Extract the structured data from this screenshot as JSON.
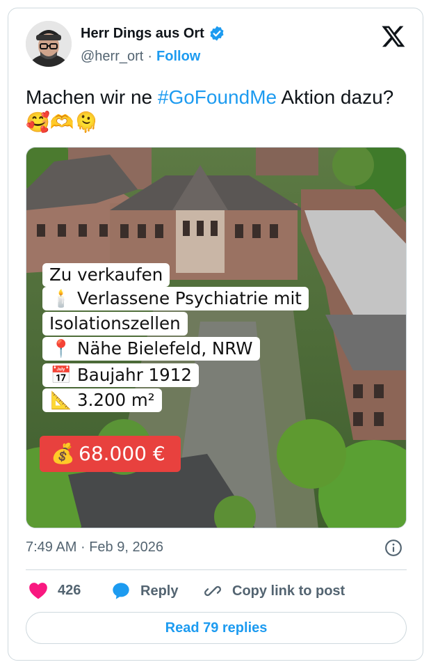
{
  "author": {
    "name": "Herr Dings aus Ort",
    "handle": "@herr_ort",
    "separator": "·",
    "follow_label": "Follow"
  },
  "tweet": {
    "text_before": "Machen wir ne ",
    "hashtag": "#GoFoundMe",
    "text_after": " Aktion dazu? 🥰🫶🫠"
  },
  "media": {
    "lines": [
      {
        "emoji": "",
        "text": "Zu verkaufen"
      },
      {
        "emoji": "🕯️",
        "text": "Verlassene Psychiatrie mit"
      },
      {
        "emoji": "",
        "text": "Isolationszellen"
      },
      {
        "emoji": "📍",
        "text": "Nähe Bielefeld, NRW"
      },
      {
        "emoji": "📅",
        "text": "Baujahr 1912"
      },
      {
        "emoji": "📐",
        "text": "3.200 m²"
      }
    ],
    "price_emoji": "💰",
    "price": "68.000 €"
  },
  "meta": {
    "time": "7:49 AM",
    "separator": "·",
    "date": "Feb 9, 2026"
  },
  "actions": {
    "likes": "426",
    "reply_label": "Reply",
    "copy_label": "Copy link to post"
  },
  "read_replies_label": "Read 79 replies",
  "colors": {
    "link_blue": "#1d9bf0",
    "like_pink": "#f91880",
    "price_red": "#e8413e",
    "muted": "#536471",
    "border": "#cfd9de"
  },
  "icons": [
    "verified-badge-icon",
    "x-logo-icon",
    "info-icon",
    "heart-icon",
    "reply-bubble-icon",
    "link-icon"
  ]
}
